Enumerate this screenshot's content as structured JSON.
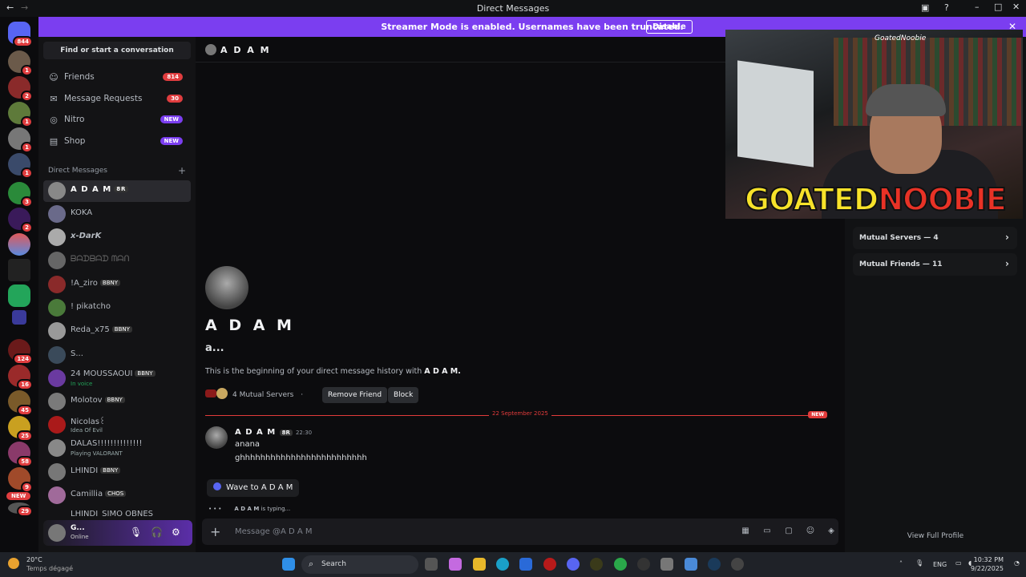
{
  "window": {
    "title": "Direct Messages"
  },
  "servers": {
    "badges": [
      "844",
      "1",
      "2",
      "1",
      "1",
      "1",
      "3",
      "2",
      "124",
      "16",
      "45",
      "25",
      "58",
      "9",
      "29"
    ],
    "new_label": "NEW"
  },
  "banner": {
    "text": "Streamer Mode is enabled. Usernames have been truncated.",
    "button": "Disable"
  },
  "dm_sidebar": {
    "search": "Find or start a conversation",
    "nav": [
      {
        "label": "Friends",
        "badge": "814",
        "icon": "friends-icon"
      },
      {
        "label": "Message Requests",
        "badge": "30",
        "icon": "envelope-icon"
      },
      {
        "label": "Nitro",
        "badge": "NEW",
        "icon": "nitro-icon"
      },
      {
        "label": "Shop",
        "badge": "NEW",
        "icon": "shop-icon"
      }
    ],
    "section_title": "Direct Messages",
    "dms": [
      {
        "name": "A D A M",
        "tag": "8R",
        "sub": ""
      },
      {
        "name": "KOKA",
        "tag": "",
        "sub": ""
      },
      {
        "name": "x-DarK",
        "tag": "",
        "sub": ""
      },
      {
        "name": "ᗷᗩᗪᗷᗩᗪ ᗰᗩᑎ",
        "tag": "",
        "sub": ""
      },
      {
        "name": "!A_ziro",
        "tag": "BBNY",
        "sub": ""
      },
      {
        "name": "! pikatcho",
        "tag": "",
        "sub": ""
      },
      {
        "name": "Reda_x75",
        "tag": "BBNY",
        "sub": ""
      },
      {
        "name": "S...",
        "tag": "",
        "sub": ""
      },
      {
        "name": "24 MOUSSAOUI",
        "tag": "BBNY",
        "sub": "In voice"
      },
      {
        "name": "Molotov",
        "tag": "BBNY",
        "sub": ""
      },
      {
        "name": "Nicolas꒰",
        "tag": "",
        "sub": "Idea Of Evil"
      },
      {
        "name": "DALAS!!!!!!!!!!!!!!",
        "tag": "",
        "sub": "Playing VALORANT"
      },
      {
        "name": "LHINDI",
        "tag": "BBNY",
        "sub": ""
      },
      {
        "name": "Camillia",
        "tag": "CHOS",
        "sub": ""
      },
      {
        "name": "LHINDI_SIMO OBNES",
        "tag": "",
        "sub": ""
      }
    ],
    "user": {
      "name": "G...",
      "status": "Online"
    }
  },
  "chat": {
    "header_title": "A D A M",
    "profile_name": "A D A M",
    "pronoun": "a...",
    "beginning_text": "This is the beginning of your direct message history with",
    "beginning_name": "A D A M.",
    "mutual_servers": "4 Mutual Servers",
    "remove_friend": "Remove Friend",
    "block": "Block",
    "date_divider": "22 September 2025",
    "new_label": "NEW",
    "message": {
      "author": "A D A M",
      "tag": "8R",
      "time": "22:30",
      "lines": [
        "anana",
        "ghhhhhhhhhhhhhhhhhhhhhhhhh"
      ]
    },
    "wave_label": "Wave to A D A M",
    "typing_name": "A D A M",
    "typing_suffix": " is typing...",
    "input_placeholder": "Message @A D A M"
  },
  "profile_panel": {
    "mutual_servers": "Mutual Servers — 4",
    "mutual_friends": "Mutual Friends — 11",
    "view_full_profile": "View Full Profile"
  },
  "stream_overlay": {
    "logo_yellow": "GOATED",
    "logo_red": "NOOBIE",
    "handle": "GoatedNoobie"
  },
  "taskbar": {
    "weather_temp": "20°C",
    "weather_desc": "Temps dégagé",
    "search": "Search",
    "language": "ENG",
    "time": "10:32 PM",
    "date": "9/22/2025"
  },
  "colors": {
    "accent": "#7b3ef0",
    "badge_red": "#e03d3f",
    "divider_red": "#e23b3b"
  }
}
